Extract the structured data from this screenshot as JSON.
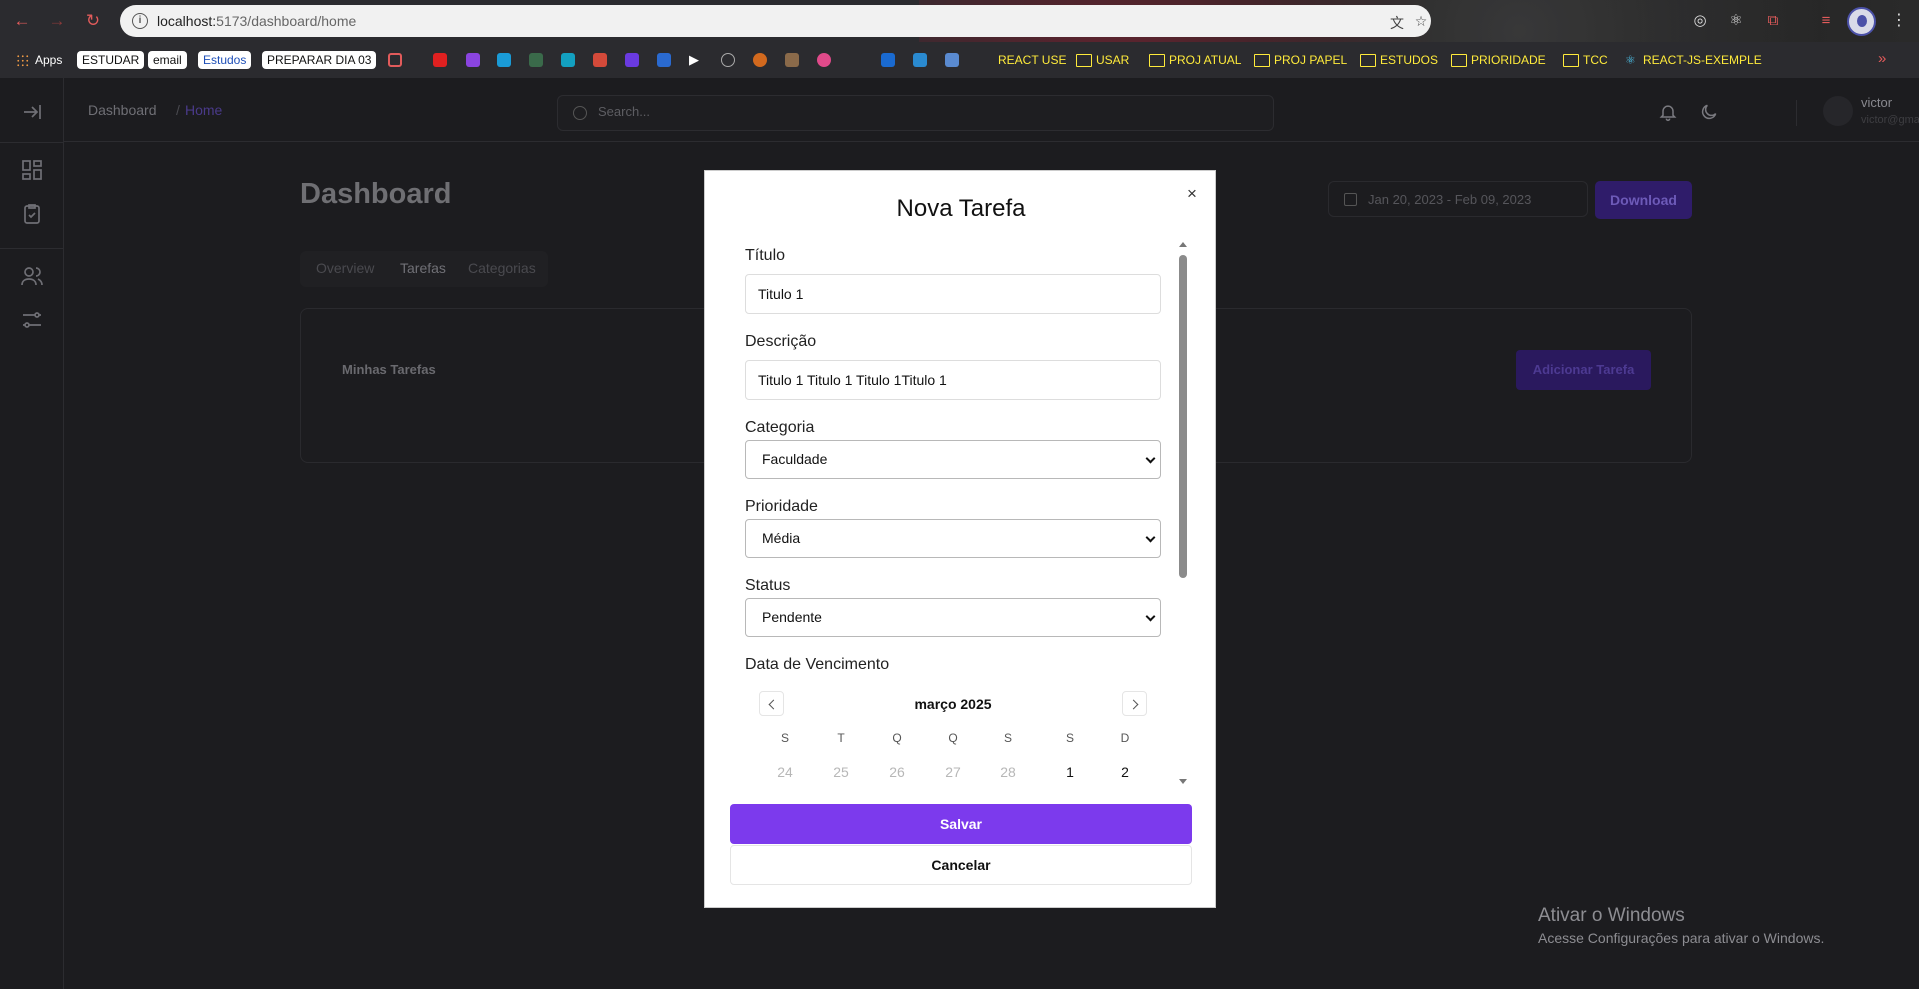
{
  "browser": {
    "url_host": "localhost:",
    "url_port_path": "5173/dashboard/home",
    "bookmarks": {
      "apps": "Apps",
      "estudar": "ESTUDAR",
      "email": "email",
      "estudos_chip": "Estudos",
      "preparar": "PREPARAR DIA 03",
      "react_use": "REACT USE",
      "usar": "USAR",
      "proj_atual": "PROJ ATUAL",
      "proj_papel": "PROJ PAPEL",
      "estudos": "ESTUDOS",
      "prioridade": "PRIORIDADE",
      "tcc": "TCC",
      "react_js": "REACT-JS-EXEMPLE"
    },
    "more_glyph": "»"
  },
  "topbar": {
    "breadcrumb": [
      "Dashboard",
      "/",
      "Home"
    ],
    "search_placeholder": "Search...",
    "user_name": "victor",
    "user_email": "victor@gmail.com"
  },
  "page": {
    "title": "Dashboard",
    "date_range": "Jan 20, 2023 - Feb 09, 2023",
    "download_label": "Download",
    "tabs": [
      "Overview",
      "Tarefas",
      "Categorias"
    ],
    "active_tab": "Tarefas",
    "card_title": "Minhas Tarefas",
    "add_task_label": "Adicionar Tarefa"
  },
  "modal": {
    "title": "Nova Tarefa",
    "close_glyph": "×",
    "fields": {
      "titulo_label": "Título",
      "titulo_value": "Titulo 1",
      "descricao_label": "Descrição",
      "descricao_value": "Titulo 1 Titulo 1 Titulo 1Titulo 1",
      "categoria_label": "Categoria",
      "categoria_value": "Faculdade",
      "prioridade_label": "Prioridade",
      "prioridade_value": "Média",
      "status_label": "Status",
      "status_value": "Pendente",
      "vencimento_label": "Data de Vencimento"
    },
    "calendar": {
      "month": "março 2025",
      "weekdays": [
        "S",
        "T",
        "Q",
        "Q",
        "S",
        "S",
        "D"
      ],
      "first_row": [
        "24",
        "25",
        "26",
        "27",
        "28",
        "1",
        "2"
      ]
    },
    "save_label": "Salvar",
    "cancel_label": "Cancelar"
  },
  "watermark": {
    "line1": "Ativar o Windows",
    "line2": "Acesse Configurações para ativar o Windows."
  },
  "colors": {
    "accent": "#7c3aed",
    "bookmark_folder": "#ffeb3b",
    "nav_red": "#e25b5b"
  }
}
